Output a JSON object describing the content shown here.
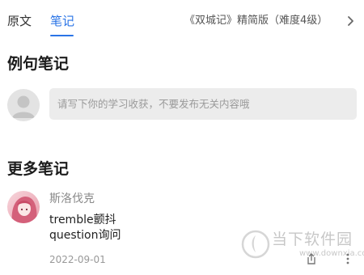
{
  "tabs": {
    "original": "原文",
    "notes": "笔记",
    "active": "notes"
  },
  "book": {
    "title": "《双城记》精简版（难度4级）",
    "chevron_icon": "chevron-right-icon"
  },
  "example_notes": {
    "title": "例句笔记",
    "avatar_icon": "default-user-avatar-icon",
    "input_placeholder": "请写下你的学习收获，不要发布无关内容哦",
    "input_value": ""
  },
  "more_notes": {
    "title": "更多笔记",
    "items": [
      {
        "user": "斯洛伐克",
        "lines": [
          "tremble颤抖",
          "question询问"
        ],
        "date": "2022-09-01"
      }
    ]
  },
  "watermark": {
    "text": "当下软件园",
    "url": "www.downxia.com"
  },
  "colors": {
    "accent": "#2a74e6",
    "input_bg": "#ececec",
    "muted_text": "#8a8a8a"
  }
}
